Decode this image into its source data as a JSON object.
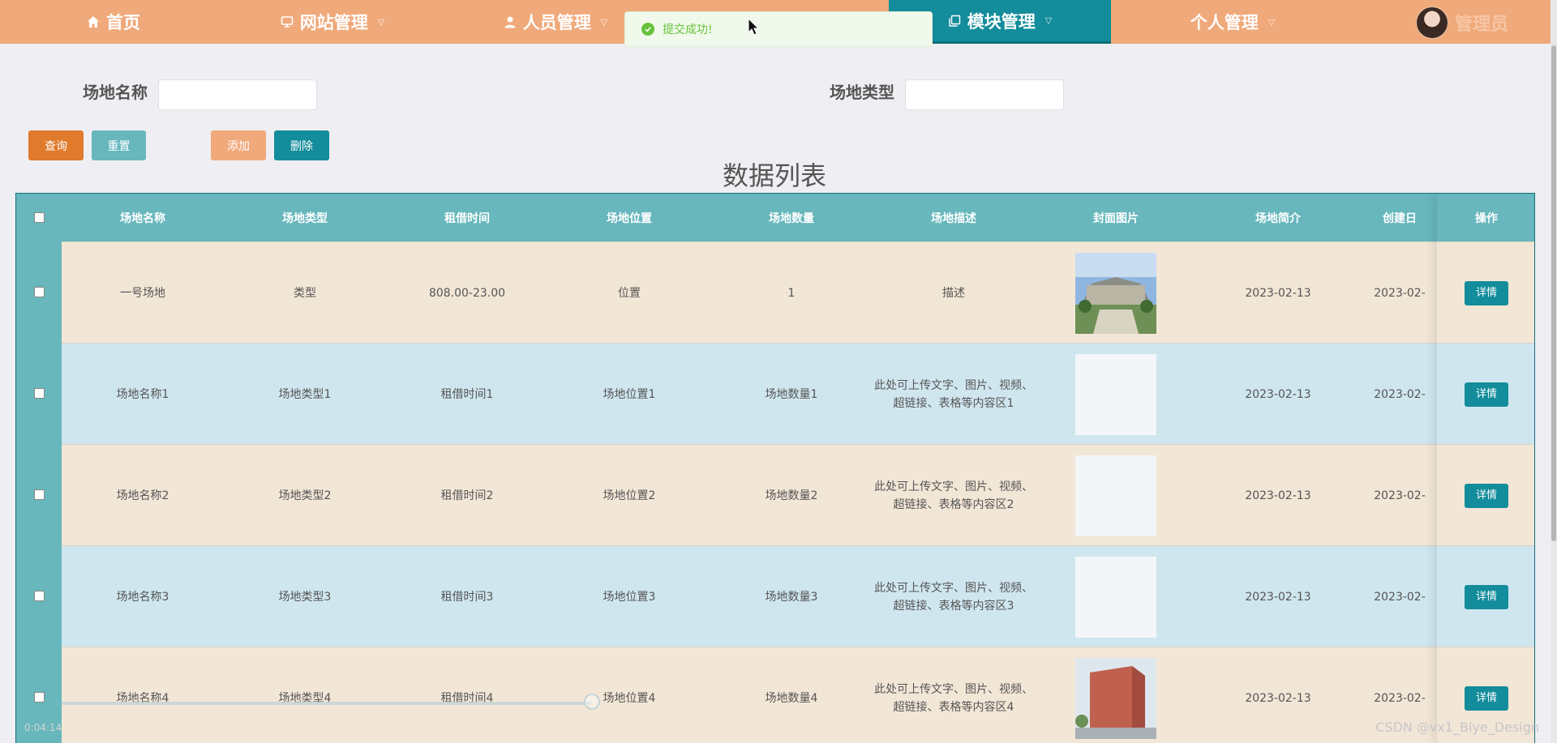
{
  "nav": {
    "items": [
      {
        "label": "首页",
        "icon": "home-icon"
      },
      {
        "label": "网站管理",
        "icon": "monitor-icon"
      },
      {
        "label": "人员管理",
        "icon": "user-icon"
      },
      {
        "label": "模块管理",
        "icon": "copy-icon"
      },
      {
        "label": "个人管理",
        "icon": ""
      }
    ],
    "active_index": 3,
    "user_name": "管理员"
  },
  "toast": {
    "message": "提交成功!"
  },
  "search": {
    "name_label": "场地名称",
    "name_value": "",
    "type_label": "场地类型",
    "type_value": ""
  },
  "buttons": {
    "query": "查询",
    "reset": "重置",
    "add": "添加",
    "delete": "删除"
  },
  "colors": {
    "nav_bg": "#f0a97a",
    "nav_active": "#138c9b",
    "query_btn": "#e07a2c",
    "reset_btn": "#67b7bd",
    "add_btn": "#f0a97a",
    "delete_btn": "#138c9b",
    "header_bg": "#67b7bd",
    "row_odd": "#f2e6d6",
    "row_even": "#cfe6ef"
  },
  "list_title": "数据列表",
  "table": {
    "headers": [
      "场地名称",
      "场地类型",
      "租借时间",
      "场地位置",
      "场地数量",
      "场地描述",
      "封面图片",
      "场地简介",
      "创建日",
      "操作"
    ],
    "rows": [
      {
        "name": "一号场地",
        "type": "类型",
        "time": "808.00-23.00",
        "location": "位置",
        "count": "1",
        "desc": "描述",
        "image": "photo",
        "intro": "2023-02-13",
        "created": "2023-02-",
        "action": "详情"
      },
      {
        "name": "场地名称1",
        "type": "场地类型1",
        "time": "租借时间1",
        "location": "场地位置1",
        "count": "场地数量1",
        "desc": "此处可上传文字、图片、视频、超链接、表格等内容区1",
        "image": "blank",
        "intro": "2023-02-13",
        "created": "2023-02-",
        "action": "详情"
      },
      {
        "name": "场地名称2",
        "type": "场地类型2",
        "time": "租借时间2",
        "location": "场地位置2",
        "count": "场地数量2",
        "desc": "此处可上传文字、图片、视频、超链接、表格等内容区2",
        "image": "blank",
        "intro": "2023-02-13",
        "created": "2023-02-",
        "action": "详情"
      },
      {
        "name": "场地名称3",
        "type": "场地类型3",
        "time": "租借时间3",
        "location": "场地位置3",
        "count": "场地数量3",
        "desc": "此处可上传文字、图片、视频、超链接、表格等内容区3",
        "image": "blank",
        "intro": "2023-02-13",
        "created": "2023-02-",
        "action": "详情"
      },
      {
        "name": "场地名称4",
        "type": "场地类型4",
        "time": "租借时间4",
        "location": "场地位置4",
        "count": "场地数量4",
        "desc": "此处可上传文字、图片、视频、超链接、表格等内容区4",
        "image": "building",
        "intro": "2023-02-13",
        "created": "2023-02-",
        "action": "详情"
      }
    ]
  },
  "watermark": "CSDN @vx1_Biye_Design",
  "timecode": "0:04:14"
}
